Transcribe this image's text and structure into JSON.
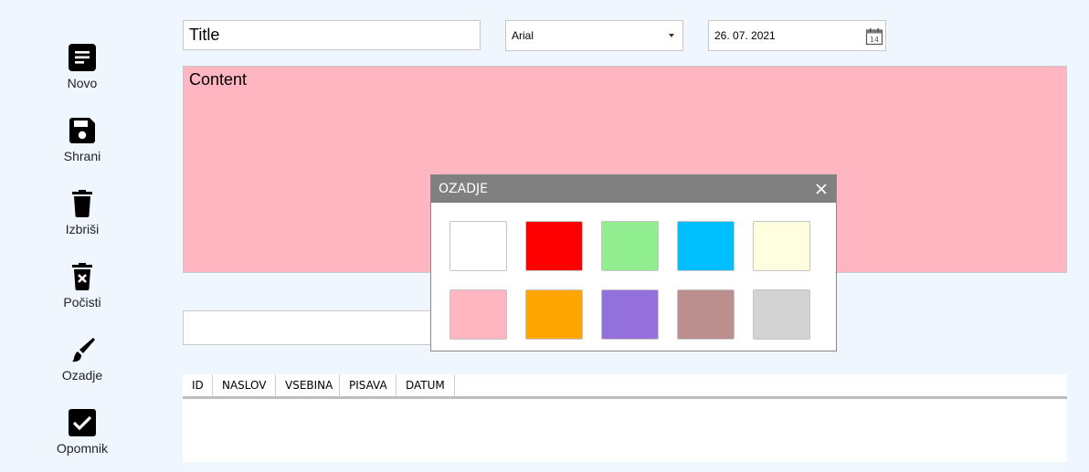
{
  "sidebar": {
    "items": [
      {
        "label": "Novo",
        "icon": "document-icon"
      },
      {
        "label": "Shrani",
        "icon": "save-icon"
      },
      {
        "label": "Izbriši",
        "icon": "trash-icon"
      },
      {
        "label": "Počisti",
        "icon": "clear-trash-icon"
      },
      {
        "label": "Ozadje",
        "icon": "brush-icon"
      },
      {
        "label": "Opomnik",
        "icon": "checkbox-icon"
      }
    ]
  },
  "editor": {
    "title_value": "Title",
    "font_value": "Arial",
    "date_value": "26. 07. 2021",
    "content_value": "Content",
    "content_background": "#ffb6c1"
  },
  "grid": {
    "columns": [
      "ID",
      "NASLOV",
      "VSEBINA",
      "PISAVA",
      "DATUM"
    ]
  },
  "dialog": {
    "title": "OZADJE",
    "swatches": [
      "#ffffff",
      "#ff0000",
      "#90ee90",
      "#00bfff",
      "#ffffe0",
      "#ffb6c1",
      "#ffa500",
      "#9370db",
      "#bc8f8f",
      "#d3d3d3"
    ]
  }
}
